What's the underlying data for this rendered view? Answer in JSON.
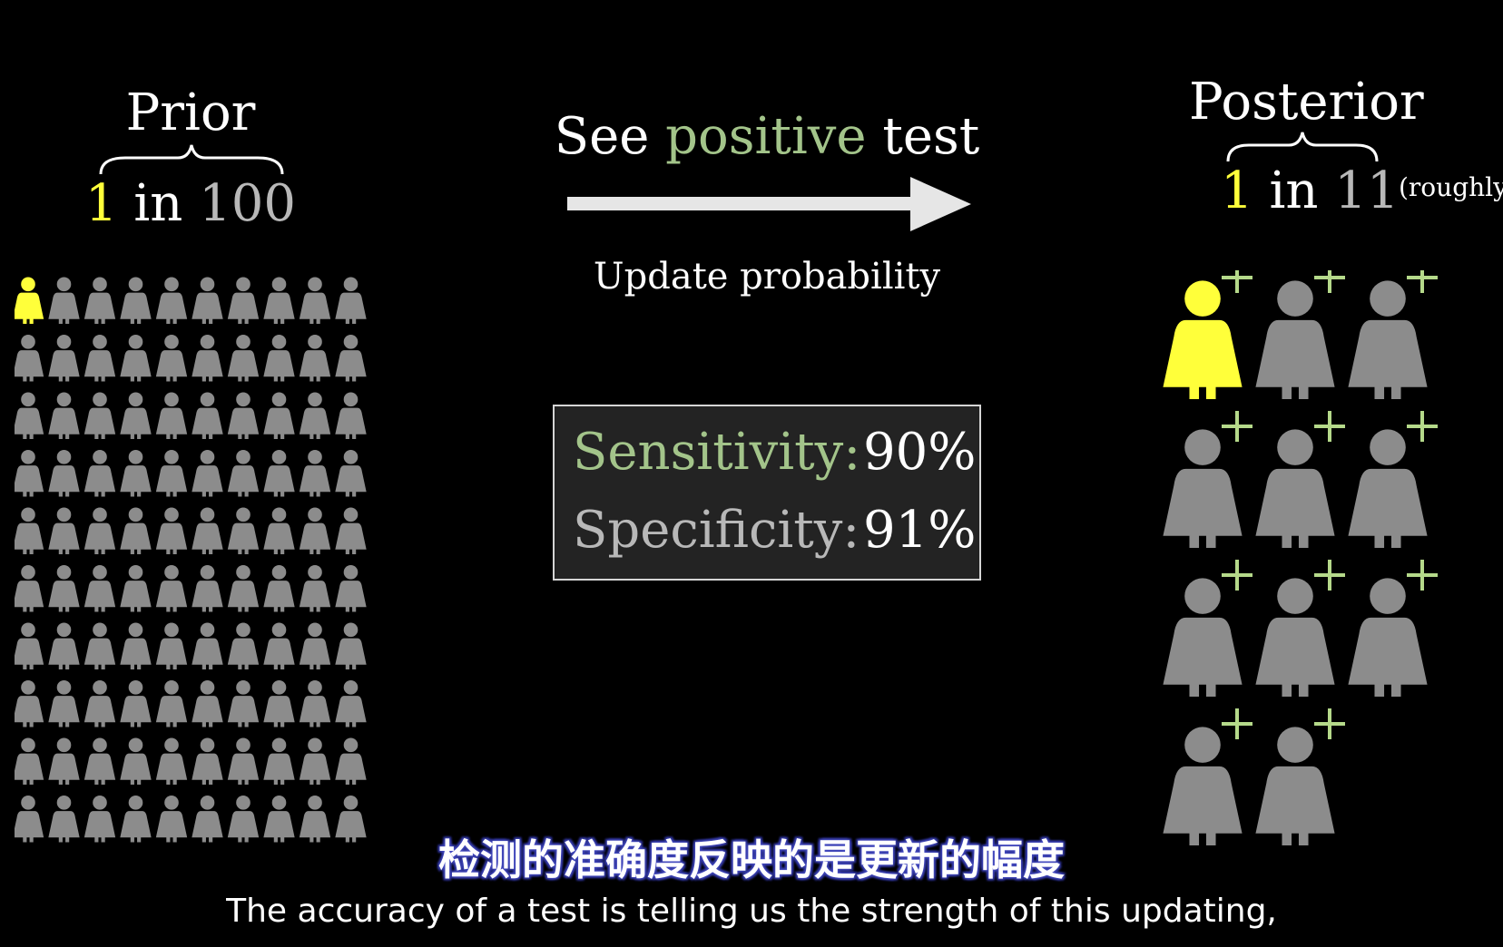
{
  "colors": {
    "background": "#000000",
    "highlight_person": "#ffff3a",
    "person": "#8c8c8c",
    "positive_green": "#a3c48a",
    "grey_text": "#b8b8b8",
    "plus": "#b5d98a"
  },
  "prior": {
    "title": "Prior",
    "ratio_num": "1",
    "ratio_in": "in",
    "ratio_den": "100",
    "grid_rows": 10,
    "grid_cols": 10,
    "highlighted_count": 1,
    "icon": "person-icon"
  },
  "transition": {
    "text_before": "See",
    "text_green": "positive",
    "text_after": "test",
    "arrow_icon": "right-arrow-icon",
    "caption": "Update probability"
  },
  "stats": {
    "sensitivity_label": "Sensitivity:",
    "sensitivity_value": "90%",
    "specificity_label": "Specificity:",
    "specificity_value": "91%"
  },
  "posterior": {
    "title": "Posterior",
    "ratio_num": "1",
    "ratio_in": "in",
    "ratio_den": "11",
    "note": "(roughly)",
    "count": 11,
    "cols": 3,
    "highlighted_count": 1,
    "icon": "person-icon",
    "badge_icon": "plus-icon"
  },
  "subtitles": {
    "zh": "检测的准确度反映的是更新的幅度",
    "en": "The accuracy of a test is telling us the strength of this updating,"
  }
}
